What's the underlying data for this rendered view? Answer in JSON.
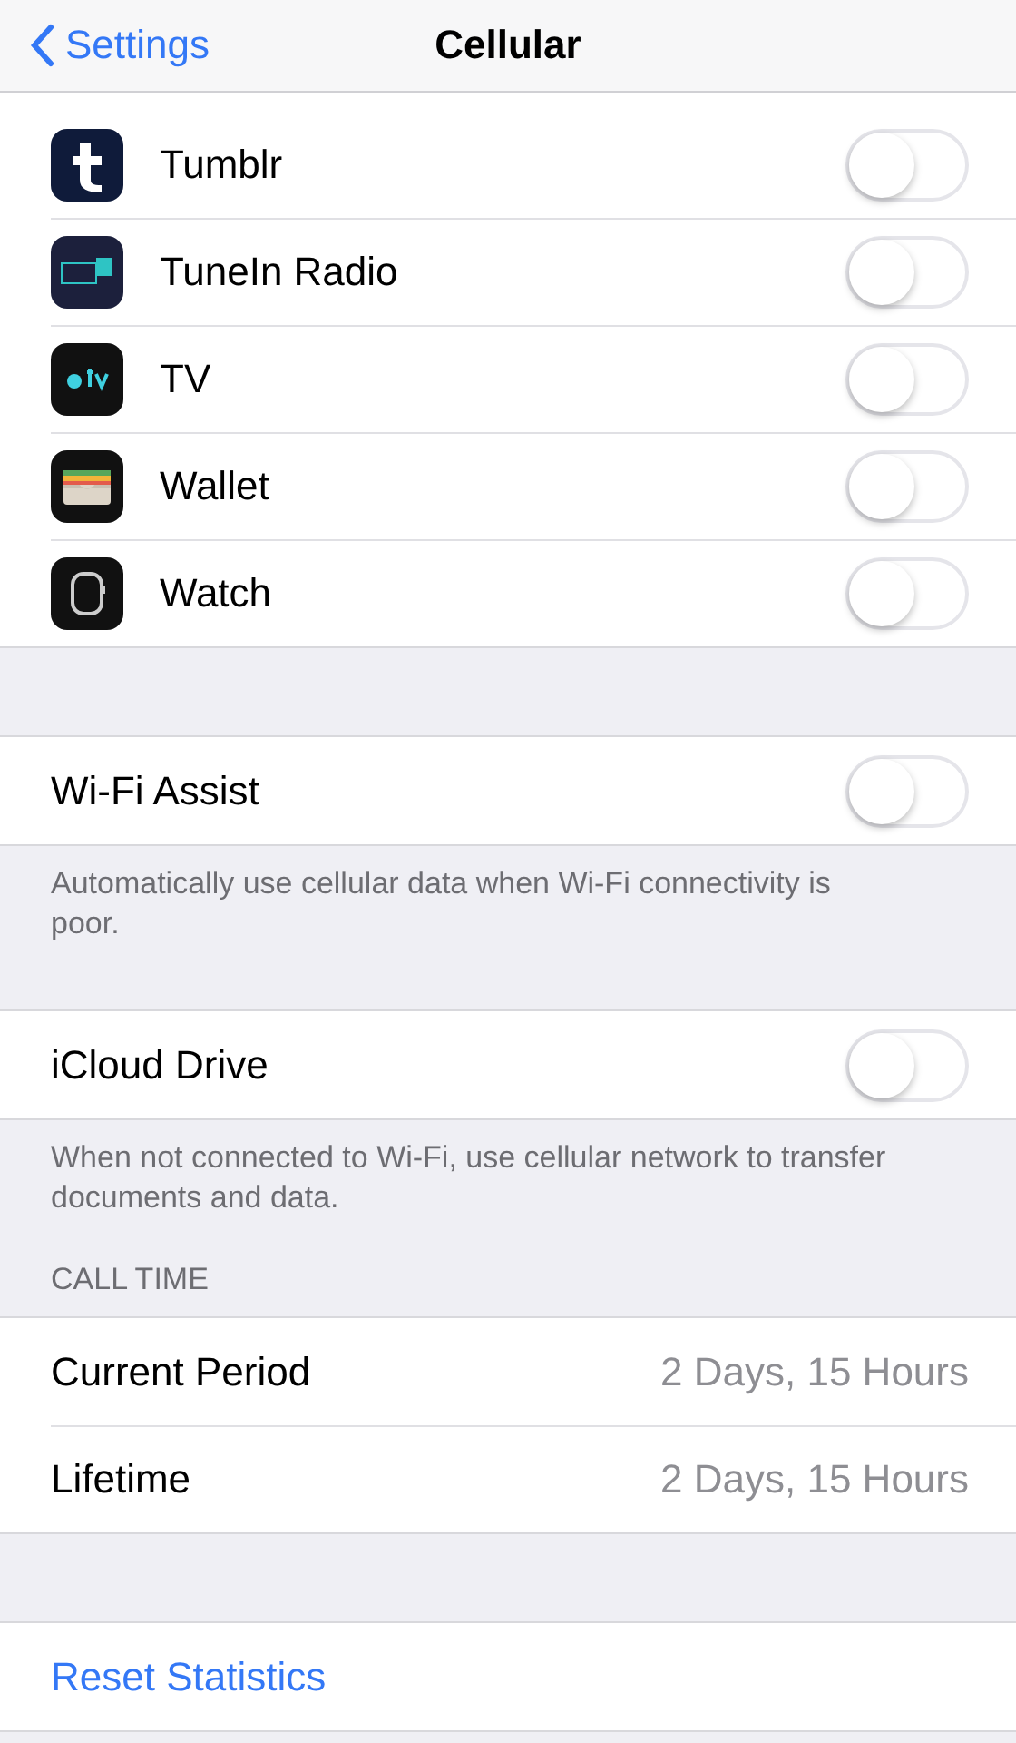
{
  "nav": {
    "back": "Settings",
    "title": "Cellular"
  },
  "apps": [
    {
      "name": "Tumblr",
      "kind": "tumblr",
      "on": false
    },
    {
      "name": "TuneIn Radio",
      "kind": "tunein",
      "on": false
    },
    {
      "name": "TV",
      "kind": "tv",
      "on": false
    },
    {
      "name": "Wallet",
      "kind": "wallet",
      "on": false
    },
    {
      "name": "Watch",
      "kind": "watch",
      "on": false
    }
  ],
  "sections": [
    {
      "rows": [
        {
          "kind": "toggle",
          "label": "Wi-Fi Assist",
          "on": false
        }
      ],
      "footer": "Automatically use cellular data when Wi-Fi connectivity is poor."
    },
    {
      "rows": [
        {
          "kind": "toggle",
          "label": "iCloud Drive",
          "on": false
        }
      ],
      "footer": "When not connected to Wi-Fi, use cellular network to transfer documents and data."
    },
    {
      "header": "CALL TIME",
      "rows": [
        {
          "kind": "value",
          "label": "Current Period",
          "value": "2 Days, 15 Hours"
        },
        {
          "kind": "value",
          "label": "Lifetime",
          "value": "2 Days, 15 Hours"
        }
      ]
    },
    {
      "rows": [
        {
          "kind": "link",
          "label": "Reset Statistics"
        }
      ]
    }
  ]
}
